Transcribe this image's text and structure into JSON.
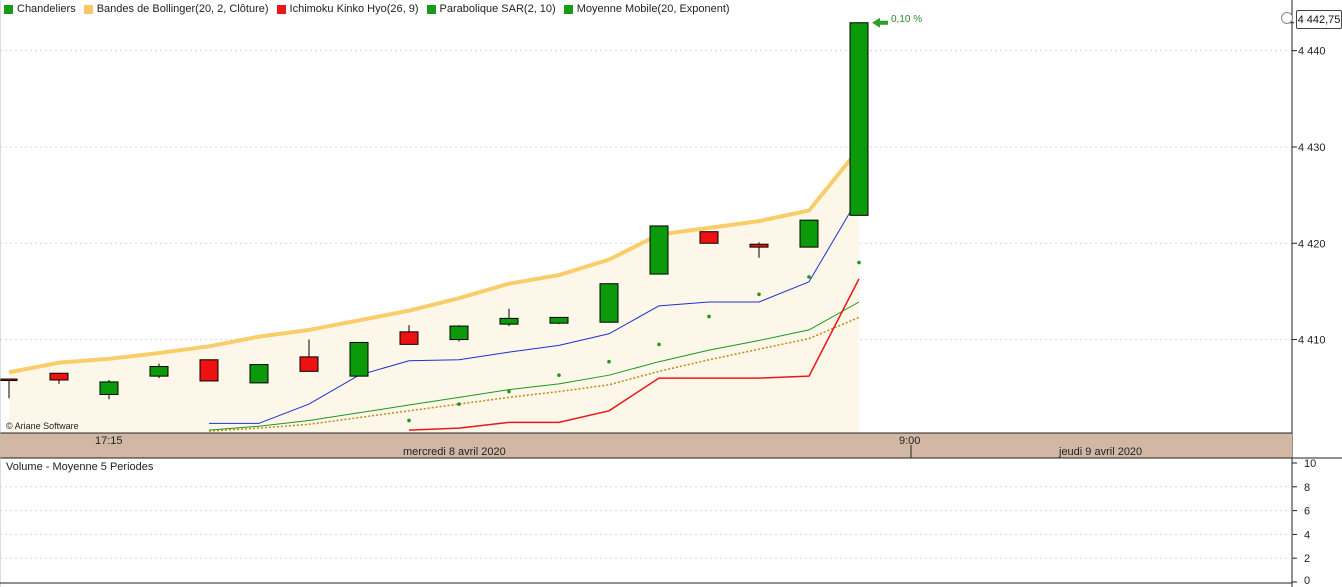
{
  "legend": [
    {
      "label": "Chandeliers",
      "color": "#1a9a1a"
    },
    {
      "label": "Bandes de Bollinger(20, 2, Clôture)",
      "color": "#f5c86a"
    },
    {
      "label": "Ichimoku Kinko Hyo(26, 9)",
      "color": "#e81818"
    },
    {
      "label": "Parabolique SAR(2, 10)",
      "color": "#1a9a1a"
    },
    {
      "label": "Moyenne Mobile(20, Exponent)",
      "color": "#1a9a1a"
    }
  ],
  "credit": "© Ariane Software",
  "last_price": "4 442,75",
  "change_pct": "0,10 %",
  "time_axis": {
    "ticks": [
      {
        "label": "17:15",
        "date": ""
      },
      {
        "label": "",
        "date": "mercredi 8 avril 2020"
      },
      {
        "label": "9:00",
        "date": ""
      },
      {
        "label": "",
        "date": "jeudi 9 avril 2020"
      }
    ]
  },
  "volume_panel": {
    "title": "Volume  - Moyenne 5 Periodes",
    "y_ticks": [
      "10",
      "8",
      "6",
      "4",
      "2",
      "0"
    ],
    "ylim": [
      0,
      10
    ]
  },
  "colors": {
    "bull": "#0a9a0a",
    "bear": "#ee1111",
    "bollinger": "#f9cd6a",
    "band_fill": "#fdf7ea",
    "mid_line": "#1f2fd0",
    "ema_line": "#1a9a1a",
    "ichimoku_line": "#e81818",
    "dotted_line": "#c08a10",
    "sar_dots": "#1a9a1a",
    "axis_strip": "#d2b7a4"
  },
  "chart_data": {
    "type": "candlestick",
    "title": "",
    "xlabel": "",
    "ylabel": "",
    "ylim": [
      4400.4,
      4443.6
    ],
    "y_ticks": [
      "4 410",
      "4 420",
      "4 430",
      "4 440"
    ],
    "candles": [
      {
        "o": 4405.9,
        "h": 4405.9,
        "l": 4403.9,
        "c": 4405.8
      },
      {
        "o": 4406.5,
        "h": 4406.5,
        "l": 4405.4,
        "c": 4405.8
      },
      {
        "o": 4404.3,
        "h": 4405.8,
        "l": 4403.8,
        "c": 4405.6
      },
      {
        "o": 4406.2,
        "h": 4407.5,
        "l": 4406.0,
        "c": 4407.2
      },
      {
        "o": 4407.9,
        "h": 4407.9,
        "l": 4405.7,
        "c": 4405.7
      },
      {
        "o": 4405.5,
        "h": 4407.4,
        "l": 4405.5,
        "c": 4407.4
      },
      {
        "o": 4408.2,
        "h": 4410.0,
        "l": 4406.7,
        "c": 4406.7
      },
      {
        "o": 4406.2,
        "h": 4409.7,
        "l": 4406.2,
        "c": 4409.7
      },
      {
        "o": 4410.8,
        "h": 4411.5,
        "l": 4409.5,
        "c": 4409.5
      },
      {
        "o": 4410.0,
        "h": 4411.5,
        "l": 4409.8,
        "c": 4411.4
      },
      {
        "o": 4411.6,
        "h": 4413.2,
        "l": 4411.4,
        "c": 4412.2
      },
      {
        "o": 4411.7,
        "h": 4412.3,
        "l": 4411.6,
        "c": 4412.3
      },
      {
        "o": 4411.8,
        "h": 4415.8,
        "l": 4411.8,
        "c": 4415.8
      },
      {
        "o": 4416.8,
        "h": 4421.8,
        "l": 4416.8,
        "c": 4421.8
      },
      {
        "o": 4421.2,
        "h": 4421.2,
        "l": 4420.0,
        "c": 4420.0
      },
      {
        "o": 4419.9,
        "h": 4420.1,
        "l": 4418.5,
        "c": 4419.6
      },
      {
        "o": 4419.6,
        "h": 4422.4,
        "l": 4419.6,
        "c": 4422.4
      },
      {
        "o": 4422.9,
        "h": 4442.9,
        "l": 4422.9,
        "c": 4442.9
      }
    ],
    "bollinger_upper": [
      4406.6,
      4407.6,
      4408.0,
      4408.6,
      4409.3,
      4410.3,
      4411.0,
      4412.0,
      4413.0,
      4414.3,
      4415.8,
      4416.7,
      4418.3,
      4420.9,
      4421.6,
      4422.3,
      4423.4,
      4429.8
    ],
    "middle_line": [
      null,
      null,
      null,
      null,
      4401.3,
      4401.3,
      4403.3,
      4406.3,
      4407.8,
      4407.9,
      4408.7,
      4409.4,
      4410.6,
      4413.5,
      4413.9,
      4413.9,
      4416.0,
      4424.8
    ],
    "ema": [
      null,
      null,
      null,
      null,
      4400.6,
      4401.0,
      4401.6,
      4402.4,
      4403.2,
      4404.0,
      4404.8,
      4405.4,
      4406.3,
      4407.7,
      4408.9,
      4409.9,
      4411.0,
      4413.9
    ],
    "dotted_line": [
      null,
      null,
      null,
      null,
      4400.5,
      4400.8,
      4401.2,
      4401.9,
      4402.6,
      4403.3,
      4404.0,
      4404.6,
      4405.3,
      4406.7,
      4407.9,
      4409.0,
      4410.1,
      4412.3
    ],
    "ichimoku": [
      null,
      null,
      null,
      null,
      null,
      null,
      null,
      null,
      4400.6,
      4400.8,
      4401.4,
      4401.4,
      4402.6,
      4406.0,
      4406.0,
      4406.0,
      4406.2,
      4416.3
    ],
    "sar": [
      null,
      null,
      null,
      null,
      null,
      null,
      null,
      null,
      4401.6,
      4403.3,
      4404.6,
      4406.3,
      4407.7,
      4409.5,
      4412.4,
      4414.7,
      4416.5,
      4418.0
    ]
  }
}
